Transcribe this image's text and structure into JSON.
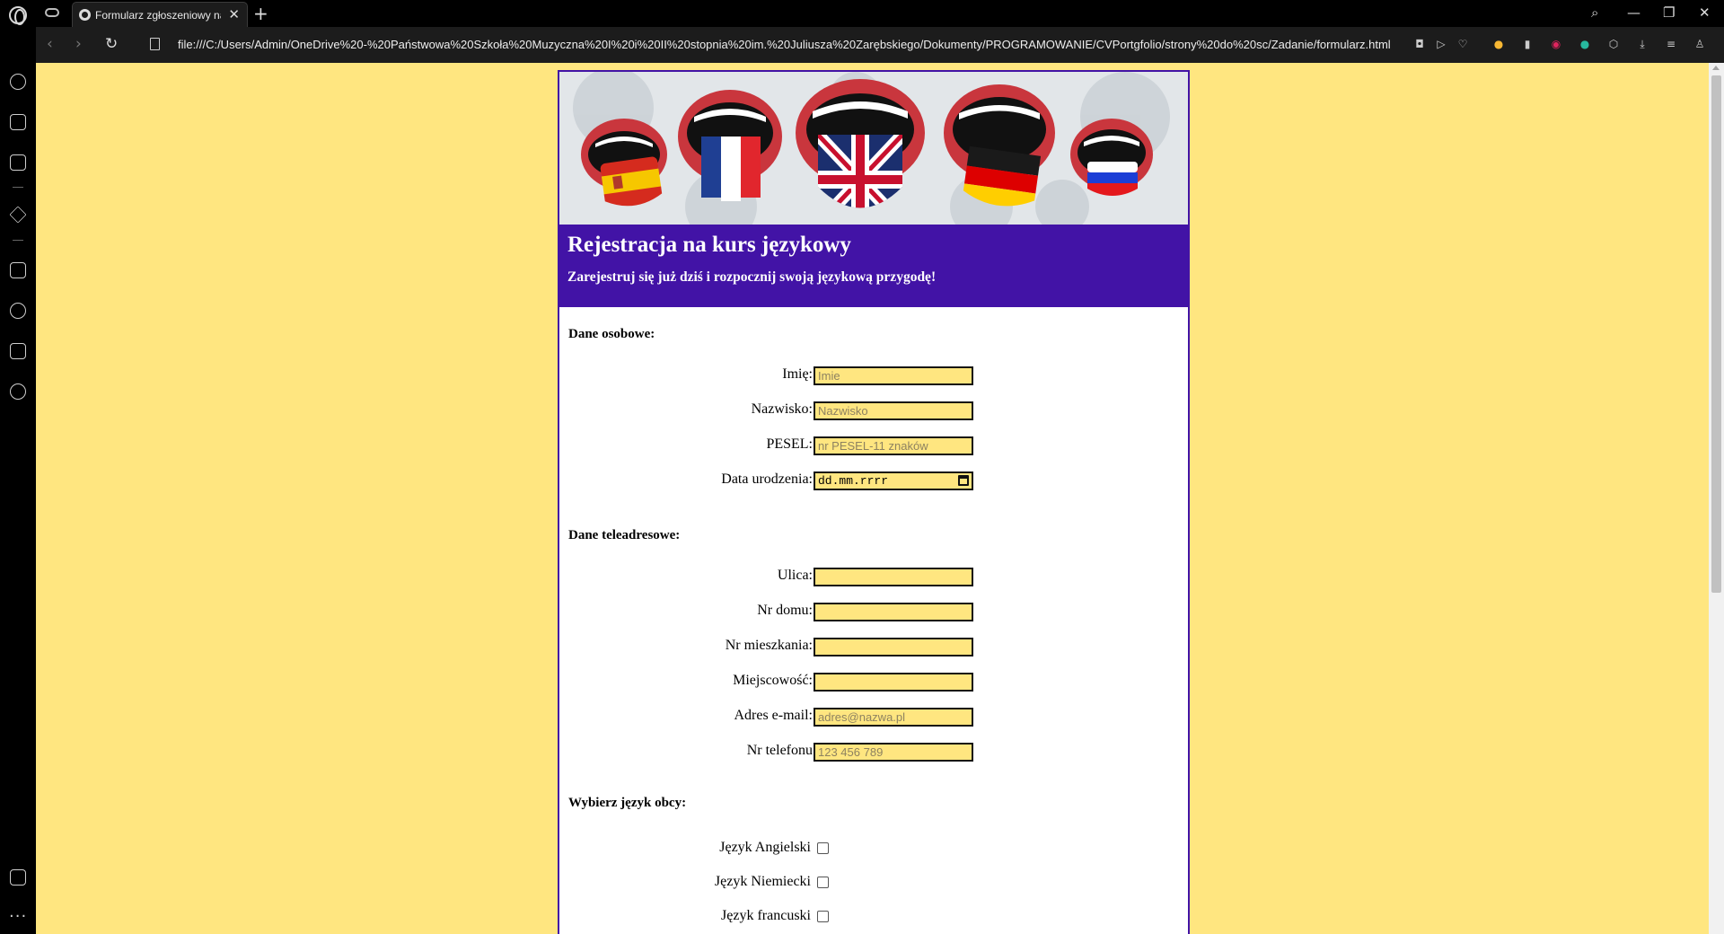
{
  "browser": {
    "tab_title": "Formularz zgłoszeniowy na kurs językowy",
    "new_tab_symbol": "+",
    "tab_close_symbol": "✕",
    "url": "file:///C:/Users/Admin/OneDrive%20-%20Państwowa%20Szkoła%20Muzyczna%20I%20i%20II%20stopnia%20im.%20Juliusza%20Zarębskiego/Dokumenty/PROGRAMOWANIE/CVPortgfolio/strony%20do%20sc/Zadanie/formularz.html",
    "nav": {
      "back": "‹",
      "forward": "›",
      "reload": "↻"
    },
    "window_controls": {
      "search": "⌕",
      "minimize": "—",
      "restore": "❐",
      "close": "✕"
    },
    "sidebar_more": "···"
  },
  "page": {
    "background_color": "#ffe680",
    "accent_color": "#4213a6",
    "title": "Rejestracja na kurs językowy",
    "subtitle": "Zarejestruj się już dziś i rozpocznij swoją językową przygodę!",
    "banner_flags": [
      "Spain",
      "France",
      "United Kingdom",
      "Germany",
      "Russia"
    ]
  },
  "personal": {
    "heading": "Dane osobowe:",
    "first_name": {
      "label": "Imię:",
      "placeholder": "Imie",
      "value": ""
    },
    "last_name": {
      "label": "Nazwisko:",
      "placeholder": "Nazwisko",
      "value": ""
    },
    "pesel": {
      "label": "PESEL:",
      "placeholder": "nr PESEL-11 znaków",
      "value": ""
    },
    "birth_date": {
      "label": "Data urodzenia:",
      "display": "dd.mm.rrrr"
    }
  },
  "contact": {
    "heading": "Dane teleadresowe:",
    "street": {
      "label": "Ulica:",
      "placeholder": "",
      "value": ""
    },
    "house_no": {
      "label": "Nr domu:",
      "placeholder": "",
      "value": ""
    },
    "flat_no": {
      "label": "Nr mieszkania:",
      "placeholder": "",
      "value": ""
    },
    "city": {
      "label": "Miejscowość:",
      "placeholder": "",
      "value": ""
    },
    "email": {
      "label": "Adres e-mail:",
      "placeholder": "adres@nazwa.pl",
      "value": ""
    },
    "phone": {
      "label": "Nr telefonu",
      "placeholder": "123 456 789",
      "value": ""
    }
  },
  "languages": {
    "heading": "Wybierz język obcy:",
    "options": [
      {
        "label": "Język Angielski",
        "checked": false
      },
      {
        "label": "Język Niemiecki",
        "checked": false
      },
      {
        "label": "Język francuski",
        "checked": false
      }
    ]
  }
}
